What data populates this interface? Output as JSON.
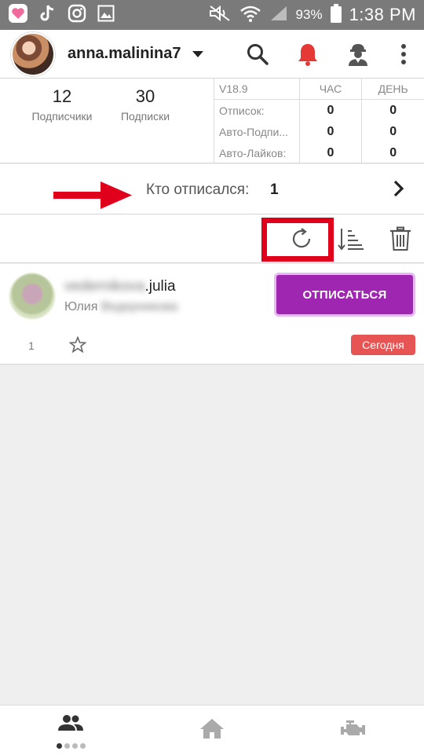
{
  "statusbar": {
    "battery": "93%",
    "time": "1:38 PM"
  },
  "header": {
    "username": "anna.malinina7"
  },
  "stats": {
    "followers": {
      "value": "12",
      "label": "Подписчики"
    },
    "following": {
      "value": "30",
      "label": "Подписки"
    },
    "version": "V18.9",
    "col_hour": "ЧАС",
    "col_day": "ДЕНЬ",
    "rows": [
      {
        "label": "Отписок:",
        "hour": "0",
        "day": "0"
      },
      {
        "label": "Авто-Подпи...",
        "hour": "0",
        "day": "0"
      },
      {
        "label": "Авто-Лайков:",
        "hour": "0",
        "day": "0"
      }
    ]
  },
  "who": {
    "label": "Кто отписался:",
    "count": "1"
  },
  "item": {
    "username_hidden": "vedernikova",
    "username_suffix": ".julia",
    "name_first": "Юлия",
    "name_hidden": "Ведерникова",
    "unsub_label": "ОТПИСАТЬСЯ",
    "index": "1",
    "badge": "Сегодня"
  },
  "colors": {
    "accent_purple": "#9e26b0",
    "bell_red": "#e53935",
    "annotation_red": "#e0001b",
    "badge_red": "#e65454"
  }
}
